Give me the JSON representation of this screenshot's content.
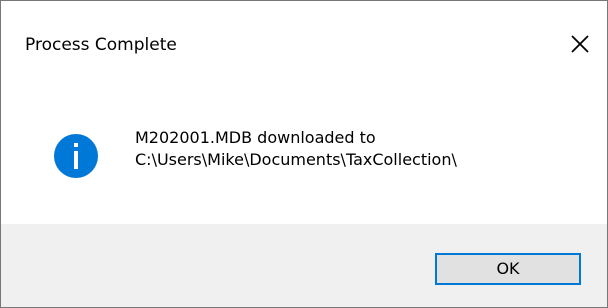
{
  "window": {
    "title": "Process Complete"
  },
  "message": {
    "line1": "M202001.MDB downloaded to",
    "line2": "C:\\Users\\Mike\\Documents\\TaxCollection\\"
  },
  "buttons": {
    "ok_label": "OK"
  },
  "icons": {
    "message_icon": "info-icon",
    "close_icon": "close-icon"
  },
  "colors": {
    "accent": "#0078d7",
    "footer_background": "#f0f0f0",
    "button_face": "#e1e1e1"
  }
}
